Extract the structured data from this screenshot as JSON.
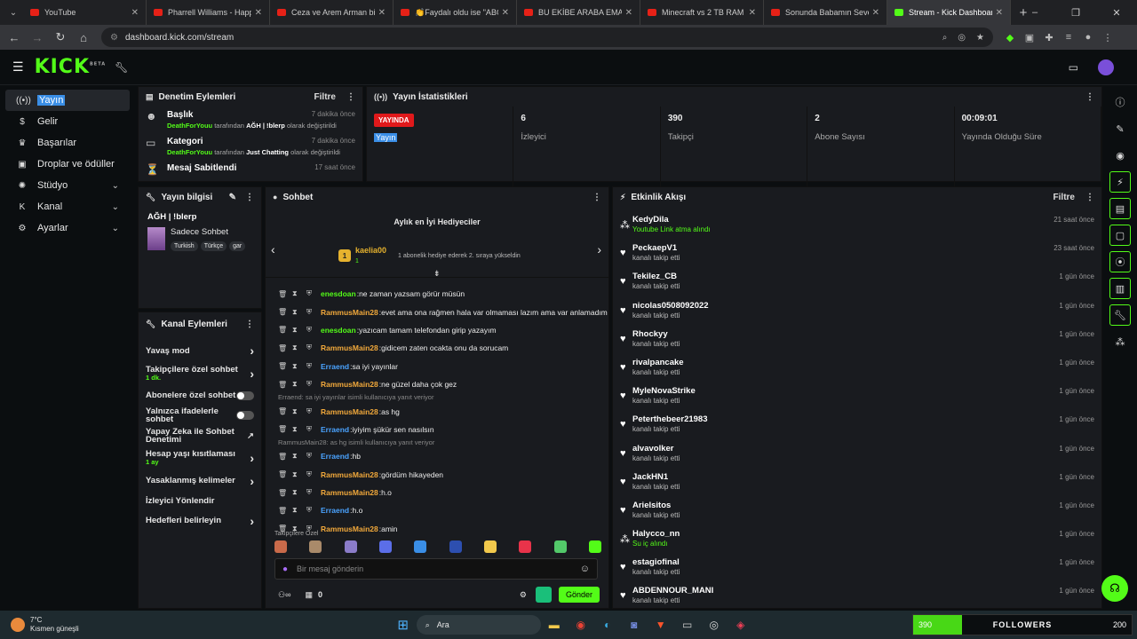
{
  "browser": {
    "tabs": [
      {
        "title": "YouTube",
        "active": false
      },
      {
        "title": "Pharrell Williams - Happy",
        "active": false
      },
      {
        "title": "Ceza ve Arem Arman bir ş",
        "active": false
      },
      {
        "title": "👏Faydalı oldu ise \"ABON",
        "active": false
      },
      {
        "title": "BU EKİBE ARABA EMANET",
        "active": false
      },
      {
        "title": "Minecraft vs 2 TB RAM - Y",
        "active": false
      },
      {
        "title": "Sonunda Babamın Sevece",
        "active": false
      },
      {
        "title": "Stream - Kick Dashboard",
        "active": true
      }
    ],
    "url": "dashboard.kick.com/stream"
  },
  "brand": {
    "logo": "KICK",
    "beta": "BETA",
    "accent": "#53fc18"
  },
  "sidebar": [
    {
      "icon": "broadcast-icon",
      "label": "Yayın",
      "active": true,
      "expand": false
    },
    {
      "icon": "dollar-icon",
      "label": "Gelir",
      "active": false,
      "expand": false
    },
    {
      "icon": "trophy-icon",
      "label": "Başarılar",
      "active": false,
      "expand": false
    },
    {
      "icon": "gift-icon",
      "label": "Droplar ve ödüller",
      "active": false,
      "expand": false
    },
    {
      "icon": "studio-icon",
      "label": "Stüdyo",
      "active": false,
      "expand": true
    },
    {
      "icon": "channel-icon",
      "label": "Kanal",
      "active": false,
      "expand": true
    },
    {
      "icon": "gear-icon",
      "label": "Ayarlar",
      "active": false,
      "expand": true
    }
  ],
  "mod_actions": {
    "title": "Denetim Eylemleri",
    "filter": "Filtre",
    "items": [
      {
        "title": "Başlık",
        "time": "7 dakika önce",
        "user": "DeathForYouu",
        "mid": "tarafından",
        "value": "AĞH | !blerp",
        "suffix": "olarak değiştirildi"
      },
      {
        "title": "Kategori",
        "time": "7 dakika önce",
        "user": "DeathForYouu",
        "mid": "tarafından",
        "value": "Just Chatting",
        "suffix": "olarak değiştirildi"
      },
      {
        "title": "Mesaj Sabitlendi",
        "time": "17 saat önce",
        "user": "",
        "mid": "",
        "value": "",
        "suffix": ""
      }
    ]
  },
  "stream_stats": {
    "title": "Yayın İstatistikleri",
    "live_badge": "YAYINDA",
    "live_label": "Yayın",
    "stats": [
      {
        "value": "6",
        "label": "İzleyici"
      },
      {
        "value": "390",
        "label": "Takipçi"
      },
      {
        "value": "2",
        "label": "Abone Sayısı"
      },
      {
        "value": "00:09:01",
        "label": "Yayında Olduğu Süre"
      }
    ]
  },
  "stream_info": {
    "title": "Yayın bilgisi",
    "stream_title": "AĞH | !blerp",
    "category": "Sadece Sohbet",
    "tags": [
      "Turkish",
      "Türkçe",
      "gar"
    ]
  },
  "channel_actions": {
    "title": "Kanal Eylemleri",
    "items": [
      {
        "label": "Yavaş mod",
        "sub": "",
        "ctrl": "chevron"
      },
      {
        "label": "Takipçilere özel sohbet",
        "sub": "1 dk.",
        "ctrl": "chevron"
      },
      {
        "label": "Abonelere özel sohbet",
        "sub": "",
        "ctrl": "toggle"
      },
      {
        "label": "Yalnızca ifadelerle sohbet",
        "sub": "",
        "ctrl": "toggle"
      },
      {
        "label": "Yapay Zeka ile Sohbet Denetimi",
        "sub": "",
        "ctrl": "external"
      },
      {
        "label": "Hesap yaşı kısıtlaması",
        "sub": "1 ay",
        "ctrl": "chevron"
      },
      {
        "label": "Yasaklanmış kelimeler",
        "sub": "",
        "ctrl": "chevron"
      },
      {
        "label": "İzleyici Yönlendir",
        "sub": "",
        "ctrl": "none"
      },
      {
        "label": "Hedefleri belirleyin",
        "sub": "",
        "ctrl": "chevron"
      }
    ]
  },
  "chat": {
    "title": "Sohbet",
    "gifters_title": "Aylık en İyi Hediyeciler",
    "top_gifter": "kaelia00",
    "top_gifter_count": "1",
    "gifter_rank": "1",
    "gifter_note": "1 abonelik hediye ederek 2. sıraya yükseldin",
    "messages": [
      {
        "user": "enesdoan",
        "color": "#53fc18",
        "text": "ne zaman yazsam görür müsün",
        "reply": ""
      },
      {
        "user": "RammusMain28",
        "color": "#f2a93b",
        "text": "evet ama ona rağmen hala var olmaması lazım ama var anlamadım",
        "reply": ""
      },
      {
        "user": "enesdoan",
        "color": "#53fc18",
        "text": "yazıcam tamam telefondan girip yazayım",
        "reply": ""
      },
      {
        "user": "RammusMain28",
        "color": "#f2a93b",
        "text": "gidicem zaten ocakta onu da sorucam",
        "reply": ""
      },
      {
        "user": "Erraend",
        "color": "#4aa3ff",
        "text": "sa iyi yayınlar",
        "reply": ""
      },
      {
        "user": "RammusMain28",
        "color": "#f2a93b",
        "text": "ne güzel daha çok gez",
        "reply": ""
      },
      {
        "user": "RammusMain28",
        "color": "#f2a93b",
        "text": "as hg",
        "reply": "Erraend: sa iyi yayınlar isimli kullanıcıya yanıt veriyor"
      },
      {
        "user": "Erraend",
        "color": "#4aa3ff",
        "text": "iyiyim şükür sen nasılsın",
        "reply": ""
      },
      {
        "user": "Erraend",
        "color": "#4aa3ff",
        "text": "hb",
        "reply": "RammusMain28: as hg isimli kullanıcıya yanıt veriyor"
      },
      {
        "user": "RammusMain28",
        "color": "#f2a93b",
        "text": "gördüm hikayeden",
        "reply": ""
      },
      {
        "user": "RammusMain28",
        "color": "#f2a93b",
        "text": "h.o",
        "reply": ""
      },
      {
        "user": "Erraend",
        "color": "#4aa3ff",
        "text": "h.o",
        "reply": ""
      },
      {
        "user": "RammusMain28",
        "color": "#f2a93b",
        "text": "amin",
        "reply": ""
      }
    ],
    "emote_label": "Takipçilere Özel",
    "input_placeholder": "Bir mesaj gönderin",
    "points": "0",
    "send": "Gönder"
  },
  "activity": {
    "title": "Etkinlik Akışı",
    "filter": "Filtre",
    "items": [
      {
        "name": "KedyDila",
        "sub": "Youtube Link atma alındı",
        "time": "21 saat önce",
        "kind": "reward"
      },
      {
        "name": "PeckaepV1",
        "sub": "kanalı takip etti",
        "time": "23 saat önce",
        "kind": "follow"
      },
      {
        "name": "Tekilez_CB",
        "sub": "kanalı takip etti",
        "time": "1 gün önce",
        "kind": "follow"
      },
      {
        "name": "nicolas0508092022",
        "sub": "kanalı takip etti",
        "time": "1 gün önce",
        "kind": "follow"
      },
      {
        "name": "Rhockyy",
        "sub": "kanalı takip etti",
        "time": "1 gün önce",
        "kind": "follow"
      },
      {
        "name": "rivalpancake",
        "sub": "kanalı takip etti",
        "time": "1 gün önce",
        "kind": "follow"
      },
      {
        "name": "MyleNovaStrike",
        "sub": "kanalı takip etti",
        "time": "1 gün önce",
        "kind": "follow"
      },
      {
        "name": "Peterthebeer21983",
        "sub": "kanalı takip etti",
        "time": "1 gün önce",
        "kind": "follow"
      },
      {
        "name": "alvavolker",
        "sub": "kanalı takip etti",
        "time": "1 gün önce",
        "kind": "follow"
      },
      {
        "name": "JackHN1",
        "sub": "kanalı takip etti",
        "time": "1 gün önce",
        "kind": "follow"
      },
      {
        "name": "Arielsitos",
        "sub": "kanalı takip etti",
        "time": "1 gün önce",
        "kind": "follow"
      },
      {
        "name": "Halycco_nn",
        "sub": "Su iç alındı",
        "time": "1 gün önce",
        "kind": "reward"
      },
      {
        "name": "estagiofinal",
        "sub": "kanalı takip etti",
        "time": "1 gün önce",
        "kind": "follow"
      },
      {
        "name": "ABDENNOUR_MANI",
        "sub": "kanalı takip etti",
        "time": "1 gün önce",
        "kind": "follow"
      }
    ]
  },
  "taskbar": {
    "weather_temp": "7°C",
    "weather_desc": "Kısmen güneşli",
    "search": "Ara",
    "followers_current": "390",
    "followers_label": "FOLLOWERS",
    "followers_goal": "200",
    "followers_progress": 1.0
  }
}
